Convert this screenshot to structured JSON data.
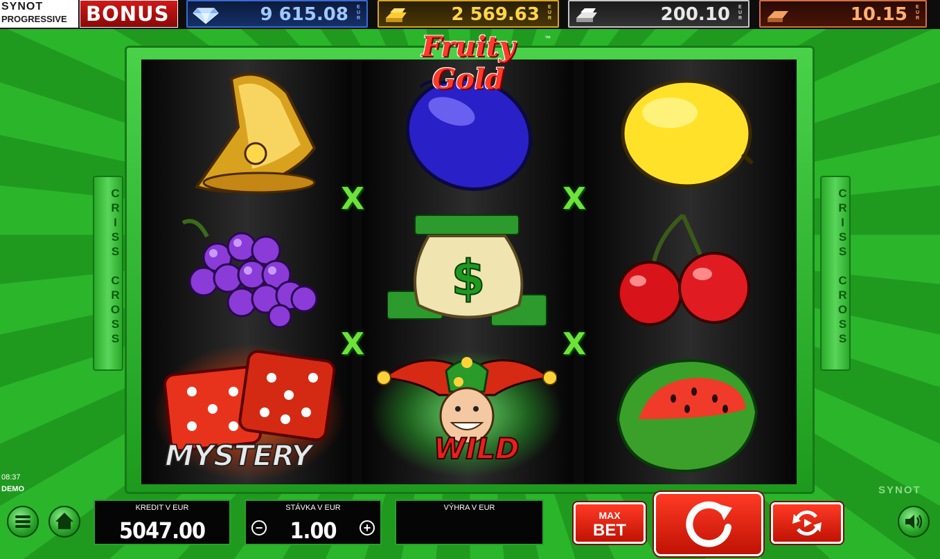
{
  "progressive": {
    "brand_top": "SYNOT",
    "brand_bottom": "PROGRESSIVE",
    "bonus_label": "BONUS"
  },
  "jackpots": [
    {
      "tier": "diamond",
      "value": "9 615.08",
      "currency": "EUR",
      "color": "#3a6ad8"
    },
    {
      "tier": "gold",
      "value": "2 569.63",
      "currency": "EUR",
      "color": "#d9a620"
    },
    {
      "tier": "silver",
      "value": "200.10",
      "currency": "EUR",
      "color": "#c8c8c8"
    },
    {
      "tier": "bronze",
      "value": "10.15",
      "currency": "EUR",
      "color": "#d47040"
    }
  ],
  "game": {
    "title": "Fruity Gold",
    "trademark": "™",
    "side_label": "CRISS CROSS",
    "cross_symbol": "X"
  },
  "reels": [
    [
      "bell",
      "grapes",
      "mystery-dice"
    ],
    [
      "plum",
      "money-bag",
      "wild-joker"
    ],
    [
      "lemon",
      "cherries",
      "watermelon"
    ]
  ],
  "symbol_text": {
    "mystery": "MYSTERY",
    "wild": "WILD"
  },
  "status": {
    "time": "08:37",
    "mode": "DEMO",
    "provider": "SYNOT"
  },
  "panels": {
    "credit_label": "KREDIT V EUR",
    "credit_value": "5047.00",
    "bet_label": "STÁVKA V EUR",
    "bet_value": "1.00",
    "win_label": "VÝHRA V EUR",
    "win_value": ""
  },
  "buttons": {
    "max_bet_line1": "MAX",
    "max_bet_line2": "BET",
    "minus": "−",
    "plus": "+"
  },
  "icons": [
    "menu-icon",
    "home-icon",
    "sound-icon",
    "spin-icon",
    "autoplay-icon"
  ],
  "colors": {
    "background": "#1c8f1c",
    "accent_red": "#e0200a",
    "accent_green": "#2aa02a"
  }
}
